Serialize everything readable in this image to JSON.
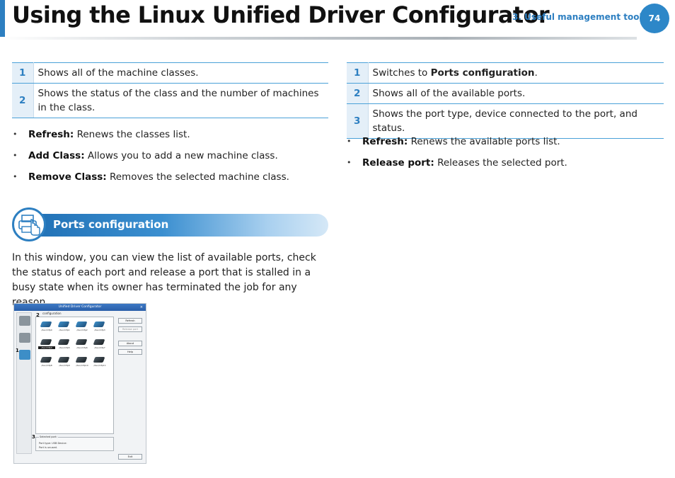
{
  "header": {
    "title": "Using the Linux Unified Driver Configurator",
    "chapter": "3.  Useful management tools",
    "page_number": "74"
  },
  "left_table": [
    {
      "num": "1",
      "desc": "Shows all of the machine classes."
    },
    {
      "num": "2",
      "desc": "Shows the status of the class and the number of machines in the class."
    }
  ],
  "left_bullets": [
    {
      "term": "Refresh:",
      "desc": " Renews the classes list."
    },
    {
      "term": "Add Class:",
      "desc": " Allows you to add a new machine class."
    },
    {
      "term": "Remove Class:",
      "desc": " Removes the selected machine class."
    }
  ],
  "section": {
    "heading": "Ports configuration",
    "icon": "printer-hand-icon"
  },
  "paragraph": "In this window, you can view the list of available ports, check the status of each port and release a port that is stalled in a busy state when its owner has terminated the job for any reason.",
  "right_table": [
    {
      "num": "1",
      "desc_prefix": "Switches to ",
      "desc_bold": "Ports configuration",
      "desc_suffix": "."
    },
    {
      "num": "2",
      "desc": "Shows all of the available ports."
    },
    {
      "num": "3",
      "desc": "Shows the port type, device connected to the port, and status."
    }
  ],
  "right_bullets": [
    {
      "term": "Refresh:",
      "desc": " Renews the available ports list."
    },
    {
      "term": "Release port:",
      "desc": " Releases the selected port."
    }
  ],
  "screenshot": {
    "window_title": "Unified Driver Configurator",
    "close_glyph": "×",
    "group_label": "configuration",
    "ports": [
      "/dev/mfp0",
      "/dev/mfp1",
      "/dev/mfp2",
      "/dev/mfp3",
      "/dev/mfp4",
      "/dev/mfp5",
      "/dev/mfp6",
      "/dev/mfp7",
      "/dev/mfp8",
      "/dev/mfp9",
      "/dev/mfp10",
      "/dev/mfp11"
    ],
    "selected_port_index": 4,
    "buttons": {
      "refresh": "Refresh",
      "release": "Release port",
      "about": "About",
      "help": "Help",
      "exit": "Exit"
    },
    "selected_title": "Selected port:",
    "selected_line1": "Port type: USB  Device:",
    "selected_line2": "Port is unused.",
    "callouts": [
      "1",
      "2",
      "3"
    ]
  }
}
